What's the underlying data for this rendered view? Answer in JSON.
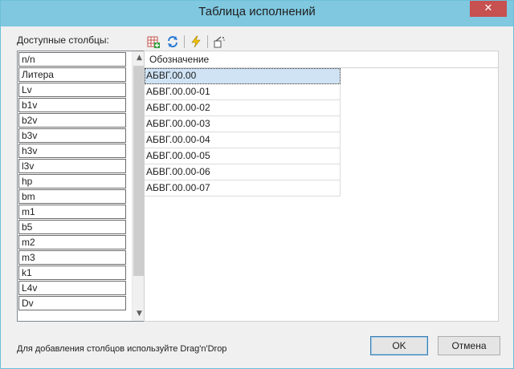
{
  "window": {
    "title": "Таблица исполнений",
    "close_glyph": "✕"
  },
  "available_columns": {
    "label": "Доступные столбцы:",
    "items": [
      "n/n",
      "Литера",
      "Lv",
      "b1v",
      "b2v",
      "b3v",
      "h3v",
      "l3v",
      "hp",
      "bm",
      "m1",
      "b5",
      "m2",
      "m3",
      "k1",
      "L4v",
      "Dv"
    ]
  },
  "toolbar": {
    "buttons": [
      {
        "icon": "add-table-icon"
      },
      {
        "icon": "refresh-icon"
      },
      {
        "icon": "lightning-icon"
      },
      {
        "icon": "clear-icon"
      }
    ]
  },
  "grid": {
    "header": "Обозначение",
    "rows": [
      "АБВГ.00.00",
      "АБВГ.00.00-01",
      "АБВГ.00.00-02",
      "АБВГ.00.00-03",
      "АБВГ.00.00-04",
      "АБВГ.00.00-05",
      "АБВГ.00.00-06",
      "АБВГ.00.00-07"
    ],
    "selected_index": 0
  },
  "hint": "Для добавления столбцов используйте Drag'n'Drop",
  "buttons": {
    "ok": "OK",
    "cancel": "Отмена"
  },
  "colors": {
    "titlebar": "#7fc8e0",
    "close": "#c75050",
    "selection": "#cfe3f5"
  }
}
